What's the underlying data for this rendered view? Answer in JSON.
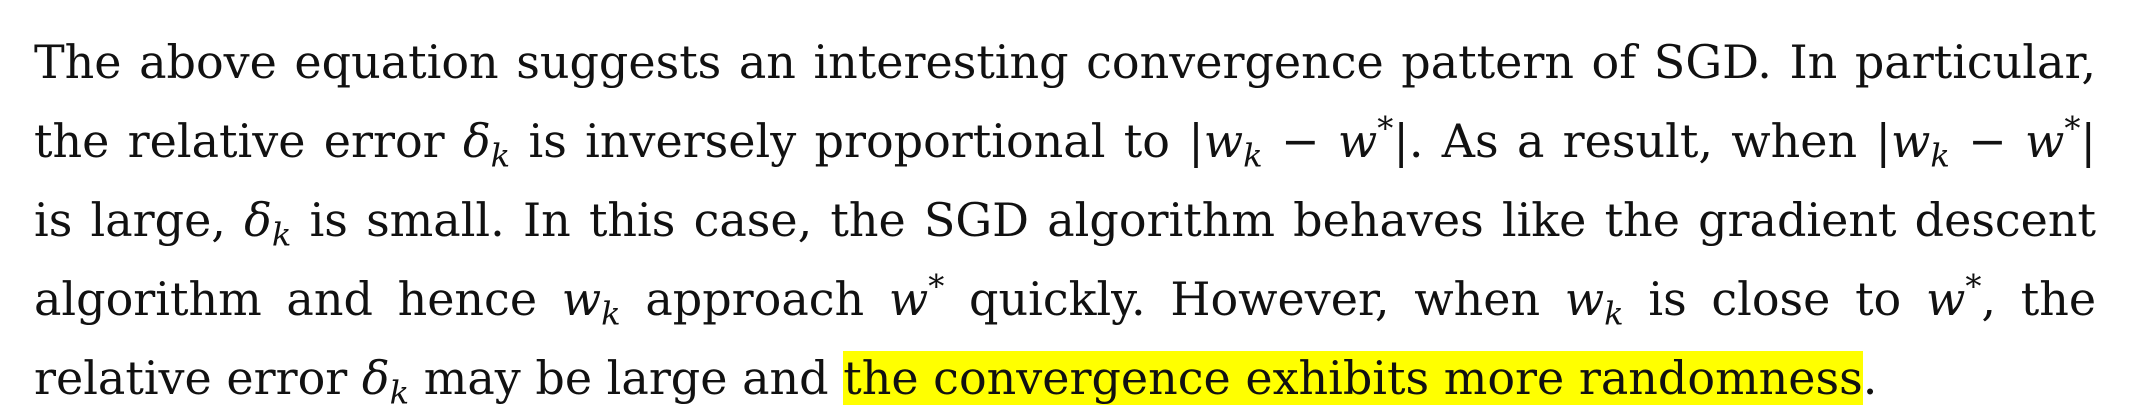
{
  "paragraph": {
    "line1": "The above equation suggests an interesting convergence pattern of SGD. In particular,",
    "line2_a": "the relative error",
    "line2_b": "is inversely proportional to",
    "line2_c": ". As a result, when",
    "line3_a": "is large,",
    "line3_b": "is small. In this case, the SGD algorithm behaves like the gradient descent",
    "line4_a": "algorithm and hence",
    "line4_b": "approach",
    "line4_c": "quickly. However, when",
    "line4_d": "is close to",
    "line4_e": ", the",
    "line5_a": "relative error",
    "line5_b": "may be large and",
    "line5_highlight": "the convergence exhibits more randomness",
    "line5_end": "."
  },
  "math": {
    "delta": "δ",
    "w": "w",
    "sub_k": "k",
    "star": "*",
    "abs_open": "|",
    "abs_close": "|",
    "minus": "−"
  },
  "colors": {
    "highlight": "#ffff00",
    "text": "#111111"
  }
}
